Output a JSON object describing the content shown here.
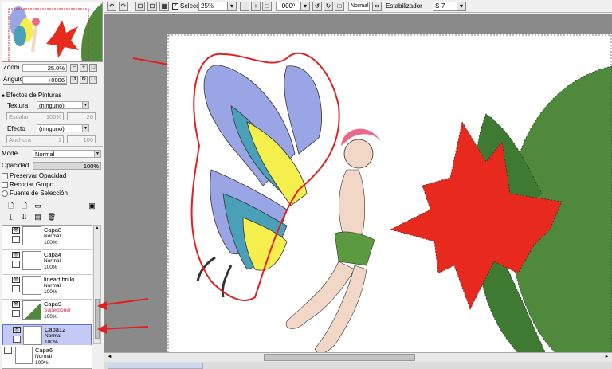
{
  "navigator": {
    "zoom_label": "Zoom",
    "zoom_value": "25.0%",
    "angle_label": "Ángulo",
    "angle_value": "+0006"
  },
  "effects": {
    "header": "Efectos de Pinturas",
    "texture_label": "Textura",
    "texture_value": "(ninguno)",
    "scale_label": "Escalar",
    "scale_value": "100%",
    "scale_num": "20",
    "effect_label": "Efecto",
    "effect_value": "(ninguno)",
    "width_label": "Anchura",
    "width_value": "1",
    "width_num": "100"
  },
  "layer_props": {
    "mode_label": "Mode",
    "mode_value": "Normal",
    "opacity_label": "Opacidad",
    "opacity_value": "100%",
    "preserve_opacity": "Preservar Opacidad",
    "clip_group": "Recortar Grupo",
    "selection_source": "Fuente de Selección"
  },
  "layers": [
    {
      "name": "Capa8",
      "mode": "Normal",
      "opacity": "100%",
      "selected": false
    },
    {
      "name": "Capa4",
      "mode": "Normal",
      "opacity": "100%",
      "selected": false
    },
    {
      "name": "lineart brillo",
      "mode": "Normal",
      "opacity": "100%",
      "selected": false
    },
    {
      "name": "Capa9",
      "mode": "Superponer",
      "opacity": "100%",
      "selected": false
    },
    {
      "name": "Capa12",
      "mode": "Normal",
      "opacity": "100%",
      "selected": true
    },
    {
      "name": "Capa6",
      "mode": "Normal",
      "opacity": "100%",
      "selected": false
    }
  ],
  "toolbar": {
    "selection_label": "Selección",
    "zoom_value": "25%",
    "angle_value": "+000º",
    "blend_value": "Normal",
    "stabilizer_label": "Estabilizador",
    "stabilizer_value": "S-7"
  },
  "colors": {
    "selected_layer": "#c5c9f5",
    "annotation_arrow": "#e02020",
    "flower_red": "#e8291e",
    "leaf_green": "#4f8a3c"
  }
}
